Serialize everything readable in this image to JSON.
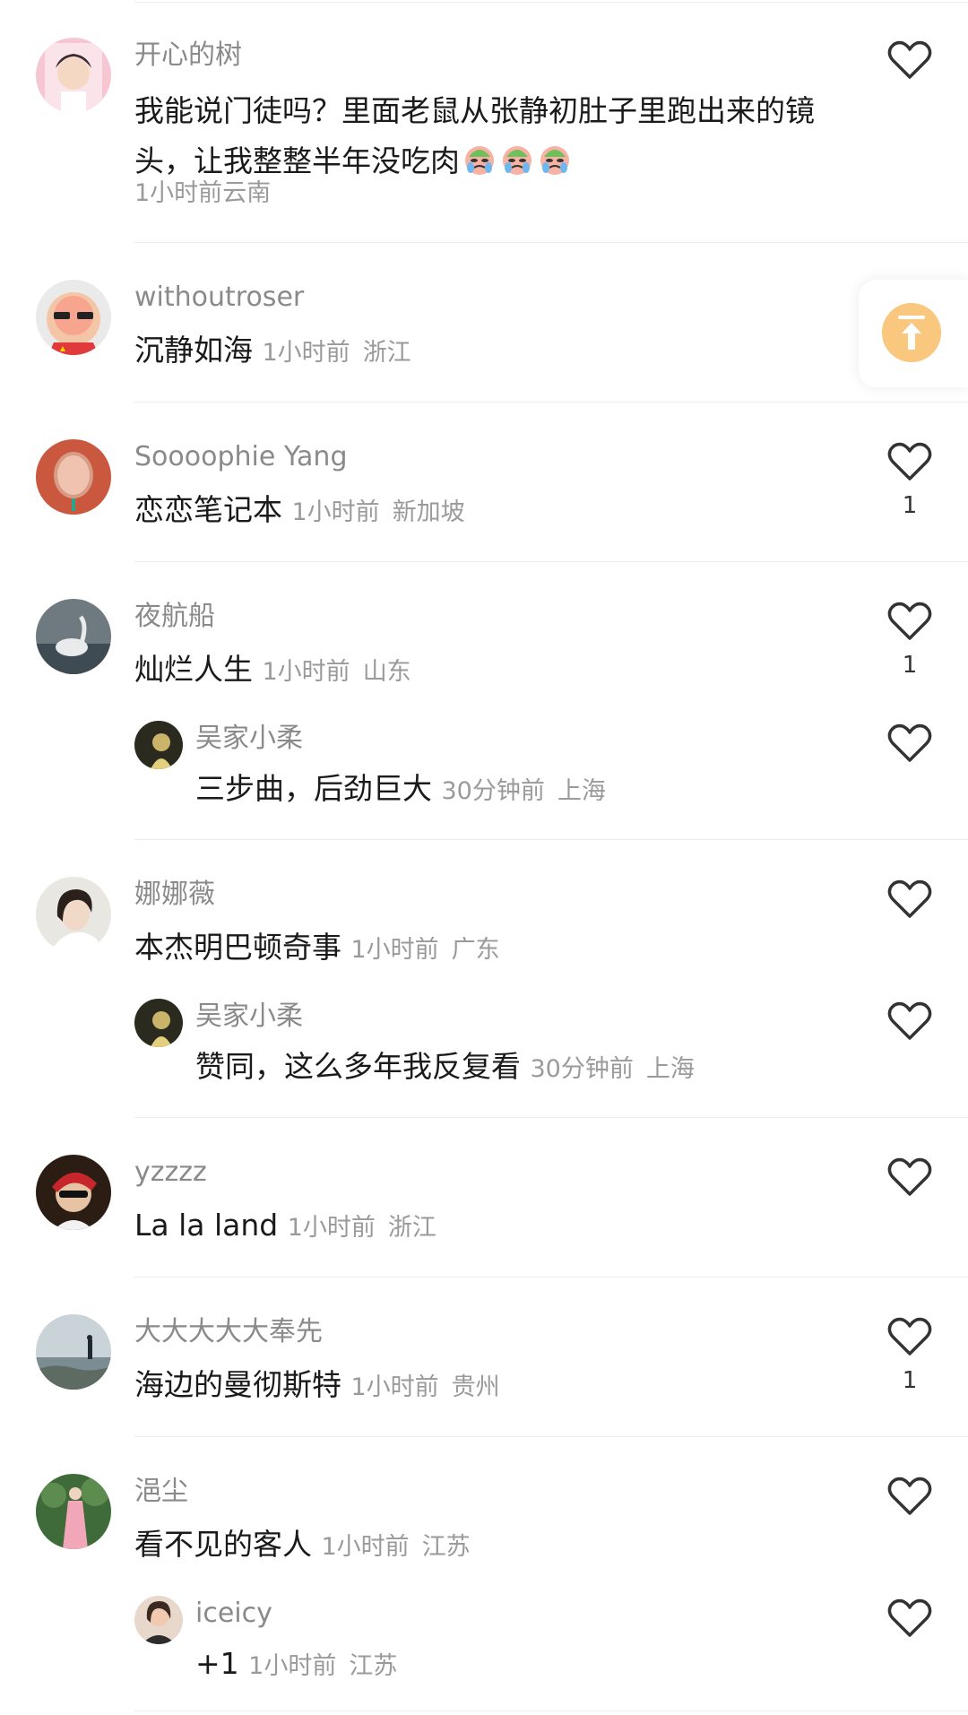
{
  "comments": [
    {
      "name": "开心的树",
      "text": "我能说门徒吗？里面老鼠从张静初肚子里跑出来的镜头，让我整整半年没吃肉",
      "emojis": [
        "crying-face-icon",
        "crying-face-icon",
        "crying-face-icon"
      ],
      "time": "1小时前",
      "location": "云南"
    },
    {
      "name": "withoutroser",
      "text": "沉静如海",
      "time": "1小时前",
      "location": "浙江"
    },
    {
      "name": "Soooophie Yang",
      "text": "恋恋笔记本",
      "time": "1小时前",
      "location": "新加坡",
      "likes": "1"
    },
    {
      "name": "夜航船",
      "text": "灿烂人生",
      "time": "1小时前",
      "location": "山东",
      "likes": "1",
      "reply": {
        "name": "吴家小柔",
        "text": "三步曲，后劲巨大",
        "time": "30分钟前",
        "location": "上海"
      }
    },
    {
      "name": "娜娜薇",
      "text": "本杰明巴顿奇事",
      "time": "1小时前",
      "location": "广东",
      "reply": {
        "name": "吴家小柔",
        "text": "赞同，这么多年我反复看",
        "time": "30分钟前",
        "location": "上海"
      }
    },
    {
      "name": "yzzzz",
      "text": "La la land",
      "time": "1小时前",
      "location": "浙江"
    },
    {
      "name": "大大大大大奉先",
      "text": "海边的曼彻斯特",
      "time": "1小时前",
      "location": "贵州",
      "likes": "1"
    },
    {
      "name": "浥尘",
      "text": "看不见的客人",
      "time": "1小时前",
      "location": "江苏",
      "reply": {
        "name": "iceicy",
        "text": "+1",
        "time": "1小时前",
        "location": "江苏"
      }
    }
  ],
  "icons": {
    "like": "heart-outline-icon",
    "float_button": "scroll-to-top-icon"
  },
  "colors": {
    "name": "#8a8a8a",
    "text": "#1a1a1a",
    "meta": "#9a9a9a",
    "float_accent": "#f9c77e"
  }
}
